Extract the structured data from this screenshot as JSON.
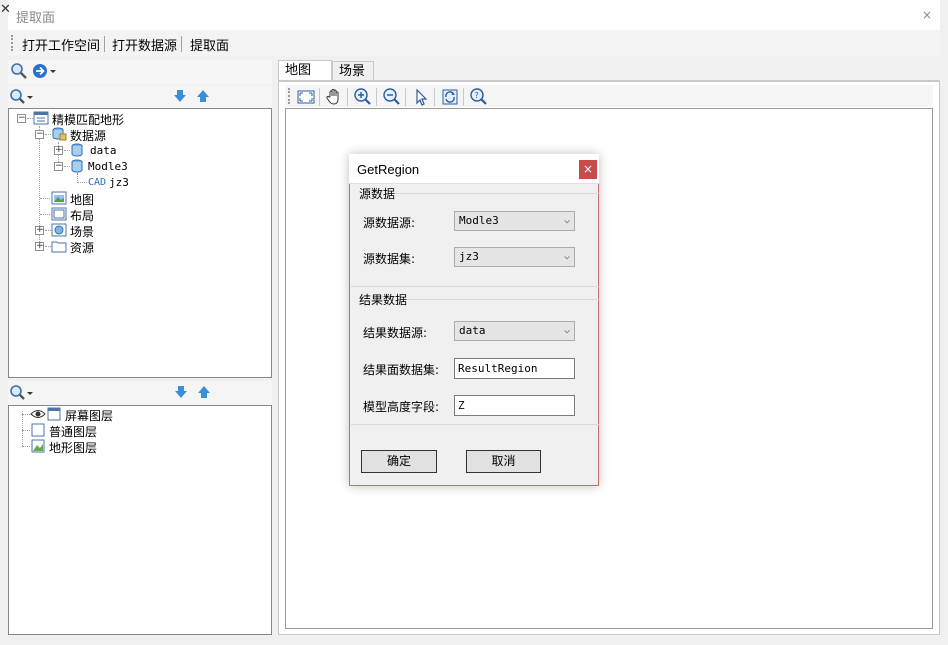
{
  "window": {
    "title": "提取面",
    "close_glyph": "×",
    "left_close_glyph": "✕"
  },
  "menubar": {
    "items": [
      "打开工作空间",
      "打开数据源",
      "提取面"
    ]
  },
  "workspace_tree": {
    "root": "精模匹配地形",
    "datasource_node": "数据源",
    "datasources": [
      "data",
      "Modle3"
    ],
    "dataset_type": "CAD",
    "dataset": "jz3",
    "other_nodes": [
      "地图",
      "布局",
      "场景",
      "资源"
    ]
  },
  "layer_tree": {
    "items": [
      "屏幕图层",
      "普通图层",
      "地形图层"
    ]
  },
  "tabs": [
    {
      "label": "地图"
    },
    {
      "label": "场景"
    }
  ],
  "map_toolbar": {
    "icons": [
      "full-extent-icon",
      "pan-icon",
      "zoom-in-icon",
      "zoom-out-icon",
      "select-icon",
      "refresh-icon",
      "query-icon"
    ]
  },
  "dialog": {
    "title": "GetRegion",
    "close_glyph": "×",
    "source_group": "源数据",
    "source_datasource_label": "源数据源:",
    "source_datasource_value": "Modle3",
    "source_dataset_label": "源数据集:",
    "source_dataset_value": "jz3",
    "result_group": "结果数据",
    "result_datasource_label": "结果数据源:",
    "result_datasource_value": "data",
    "result_dataset_label": "结果面数据集:",
    "result_dataset_value": "ResultRegion",
    "height_field_label": "模型高度字段:",
    "height_field_value": "Z",
    "ok_label": "确定",
    "cancel_label": "取消"
  },
  "colors": {
    "dialog_close_bg": "#c94a4a",
    "icon_blue": "#2a7fd4",
    "folder_yellow": "#e8c15a"
  }
}
